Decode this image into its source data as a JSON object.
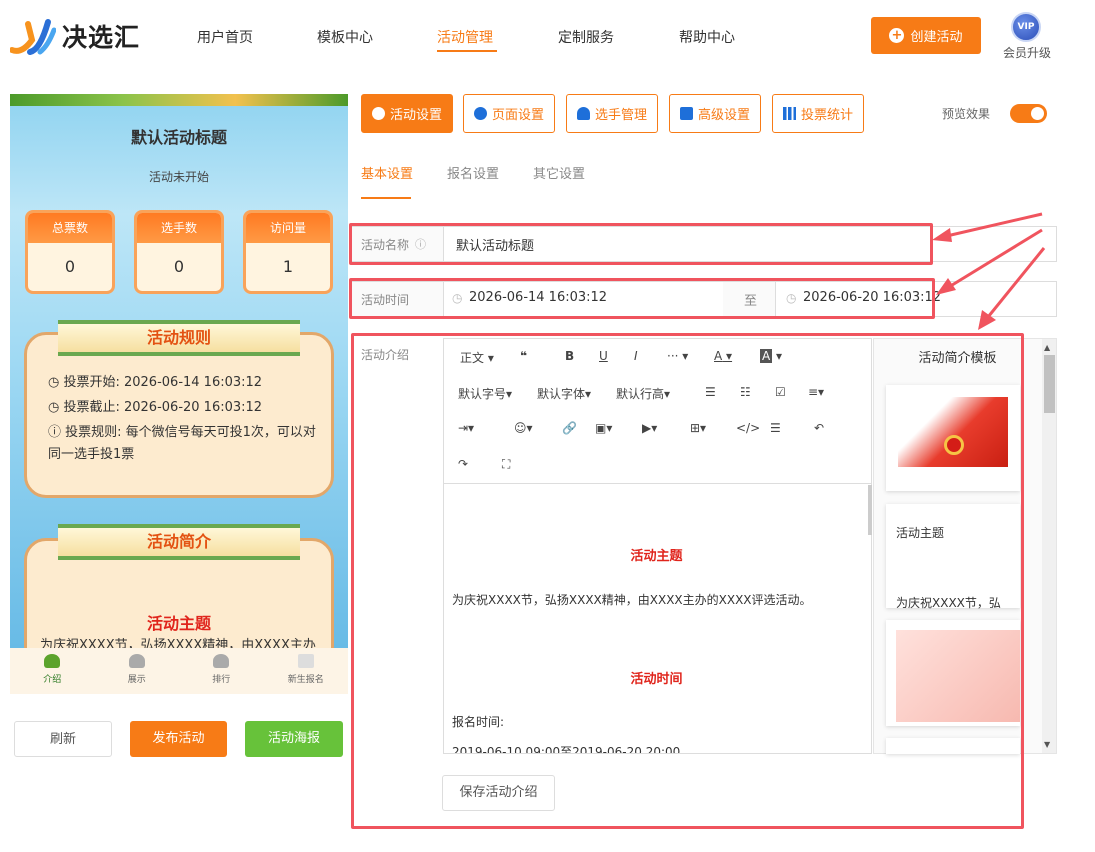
{
  "header": {
    "logo_text": "决选汇",
    "nav": [
      "用户首页",
      "模板中心",
      "活动管理",
      "定制服务",
      "帮助中心"
    ],
    "create_label": "创建活动",
    "vip_badge": "VIP",
    "vip_label": "会员升级"
  },
  "preview": {
    "title": "默认活动标题",
    "status": "活动未开始",
    "stats": [
      {
        "label": "总票数",
        "value": "0"
      },
      {
        "label": "选手数",
        "value": "0"
      },
      {
        "label": "访问量",
        "value": "1"
      }
    ],
    "rules_title": "活动规则",
    "rules": [
      "投票开始:  2026-06-14 16:03:12",
      "投票截止:  2026-06-20 16:03:12",
      "投票规则:  每个微信号每天可投1次，可以对同一选手投1票"
    ],
    "intro_title": "活动简介",
    "theme": "活动主题",
    "intro_text": "为庆祝XXXX节，弘扬XXXX精神，由XXXX主办",
    "tabs": [
      "介绍",
      "展示",
      "排行",
      "新生报名"
    ]
  },
  "left_buttons": {
    "refresh": "刷新",
    "publish": "发布活动",
    "poster": "活动海报"
  },
  "toolbar": {
    "buttons": [
      "活动设置",
      "页面设置",
      "选手管理",
      "高级设置",
      "投票统计"
    ],
    "preview_label": "预览效果"
  },
  "subtabs": [
    "基本设置",
    "报名设置",
    "其它设置"
  ],
  "form": {
    "name_label": "活动名称",
    "name_value": "默认活动标题",
    "time_label": "活动时间",
    "start": "2026-06-14 16:03:12",
    "to": "至",
    "end": "2026-06-20 16:03:12",
    "intro_label": "活动介绍",
    "save_label": "保存活动介绍"
  },
  "editor": {
    "row1": [
      "正文",
      "❝",
      "B",
      "U",
      "I",
      "···",
      "A",
      "A"
    ],
    "row2": [
      "默认字号",
      "默认字体",
      "默认行高"
    ],
    "content": {
      "theme": "活动主题",
      "theme_text": "为庆祝XXXX节，弘扬XXXX精神，由XXXX主办的XXXX评选活动。",
      "time_title": "活动时间",
      "signup": "报名时间:",
      "signup_range": "2019-06-10 09:00至2019-06-20 20:00"
    }
  },
  "templates": {
    "title": "活动简介模板",
    "card2_title": "活动主题",
    "card2_text": "为庆祝XXXX节，弘"
  }
}
